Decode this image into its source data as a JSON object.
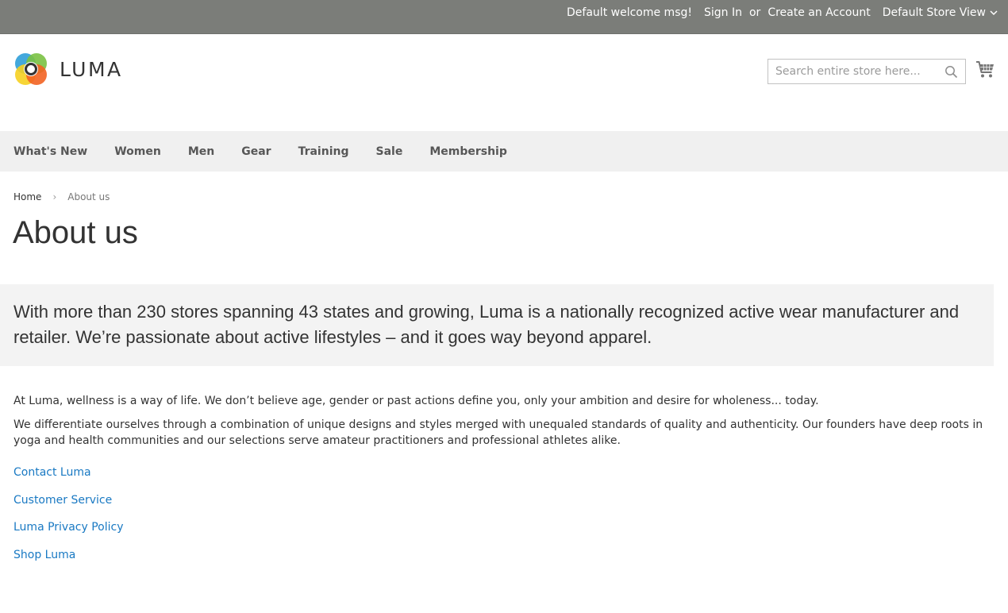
{
  "topbar": {
    "welcome": "Default welcome msg!",
    "sign_in": "Sign In",
    "or": "or",
    "create_account": "Create an Account",
    "store_view": "Default Store View"
  },
  "header": {
    "logo_text": "LUMA",
    "search_placeholder": "Search entire store here...",
    "search_value": ""
  },
  "nav": {
    "items": [
      "What's New",
      "Women",
      "Men",
      "Gear",
      "Training",
      "Sale",
      "Membership"
    ]
  },
  "breadcrumb": {
    "home": "Home",
    "separator": "›",
    "current": "About us"
  },
  "page": {
    "title": "About us",
    "intro": "With more than 230 stores spanning 43 states and growing, Luma is a nationally recognized active wear manufacturer and retailer. We’re passionate about active lifestyles – and it goes way beyond apparel.",
    "paragraphs": [
      "At Luma, wellness is a way of life. We don’t believe age, gender or past actions define you, only your ambition and desire for wholeness... today.",
      "We differentiate ourselves through a combination of unique designs and styles merged with unequaled standards of quality and authenticity. Our founders have deep roots in yoga and health communities and our selections serve amateur practitioners and professional athletes alike."
    ],
    "links": [
      "Contact Luma",
      "Customer Service",
      "Luma Privacy Policy",
      "Shop Luma"
    ]
  },
  "colors": {
    "topbar_bg": "#7b7d79",
    "nav_bg": "#f0f0f0",
    "link": "#1979c3",
    "logo_orange": "#f26322",
    "logo_blue": "#2f9fd8",
    "logo_green": "#7ac143",
    "logo_yellow": "#f6d020"
  }
}
